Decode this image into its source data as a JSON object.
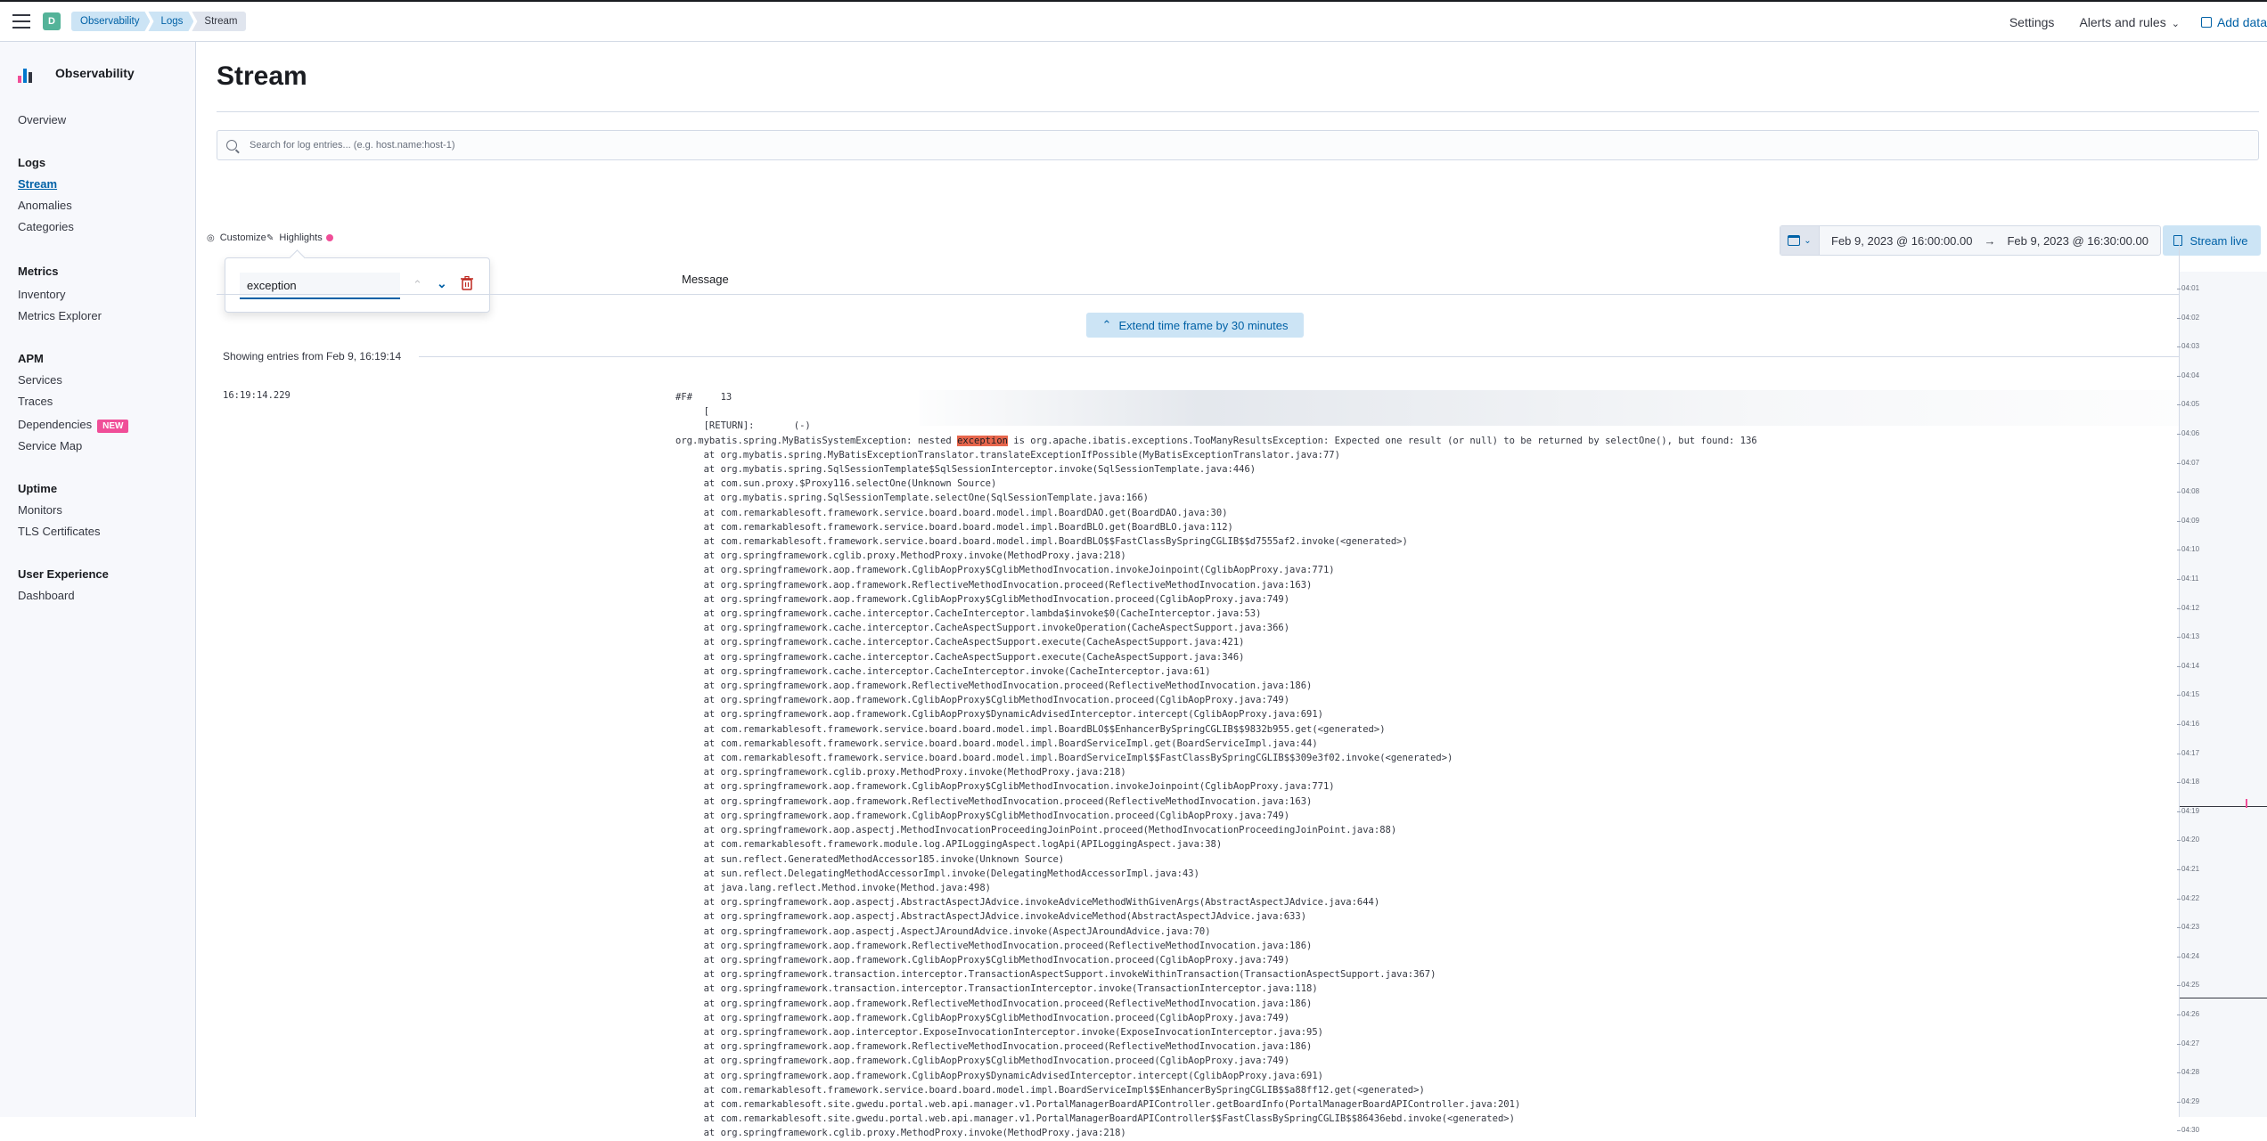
{
  "topbar": {
    "space_initial": "D",
    "breadcrumbs": [
      "Observability",
      "Logs",
      "Stream"
    ],
    "settings": "Settings",
    "alerts": "Alerts and rules",
    "add_data": "Add data"
  },
  "sidebar": {
    "title": "Observability",
    "sections": [
      {
        "items": [
          "Overview"
        ]
      },
      {
        "heading": "Logs",
        "items": [
          "Stream",
          "Anomalies",
          "Categories"
        ]
      },
      {
        "heading": "Metrics",
        "items": [
          "Inventory",
          "Metrics Explorer"
        ]
      },
      {
        "heading": "APM",
        "items": [
          "Services",
          "Traces",
          "Dependencies",
          "Service Map"
        ]
      },
      {
        "heading": "Uptime",
        "items": [
          "Monitors",
          "TLS Certificates"
        ]
      },
      {
        "heading": "User Experience",
        "items": [
          "Dashboard"
        ]
      }
    ],
    "active_item": "Stream",
    "new_badge": "NEW"
  },
  "page": {
    "title": "Stream",
    "search_placeholder": "Search for log entries... (e.g. host.name:host-1)",
    "customize": "Customize",
    "highlights": "Highlights",
    "date_from": "Feb 9, 2023 @ 16:00:00.00",
    "date_to": "Feb 9, 2023 @ 16:30:00.00",
    "stream_live": "Stream live",
    "highlight_term": "exception",
    "message_column": "Message",
    "extend_btn": "Extend time frame by 30 minutes",
    "showing": "Showing entries from Feb 9, 16:19:14"
  },
  "log": {
    "timestamp": "16:19:14.229",
    "prefix": "#F#",
    "line_id": "13",
    "return_line": "[RETURN]:       (-)",
    "exception_prefix": "org.mybatis.spring.MyBatisSystemException: nested ",
    "exception_word": "exception",
    "exception_suffix": " is org.apache.ibatis.exceptions.TooManyResultsException: Expected one result (or null) to be returned by selectOne(), but found: 136",
    "stack": [
      "at org.mybatis.spring.MyBatisExceptionTranslator.translateExceptionIfPossible(MyBatisExceptionTranslator.java:77)",
      "at org.mybatis.spring.SqlSessionTemplate$SqlSessionInterceptor.invoke(SqlSessionTemplate.java:446)",
      "at com.sun.proxy.$Proxy116.selectOne(Unknown Source)",
      "at org.mybatis.spring.SqlSessionTemplate.selectOne(SqlSessionTemplate.java:166)",
      "at com.remarkablesoft.framework.service.board.board.model.impl.BoardDAO.get(BoardDAO.java:30)",
      "at com.remarkablesoft.framework.service.board.board.model.impl.BoardBLO.get(BoardBLO.java:112)",
      "at com.remarkablesoft.framework.service.board.board.model.impl.BoardBLO$$FastClassBySpringCGLIB$$d7555af2.invoke(<generated>)",
      "at org.springframework.cglib.proxy.MethodProxy.invoke(MethodProxy.java:218)",
      "at org.springframework.aop.framework.CglibAopProxy$CglibMethodInvocation.invokeJoinpoint(CglibAopProxy.java:771)",
      "at org.springframework.aop.framework.ReflectiveMethodInvocation.proceed(ReflectiveMethodInvocation.java:163)",
      "at org.springframework.aop.framework.CglibAopProxy$CglibMethodInvocation.proceed(CglibAopProxy.java:749)",
      "at org.springframework.cache.interceptor.CacheInterceptor.lambda$invoke$0(CacheInterceptor.java:53)",
      "at org.springframework.cache.interceptor.CacheAspectSupport.invokeOperation(CacheAspectSupport.java:366)",
      "at org.springframework.cache.interceptor.CacheAspectSupport.execute(CacheAspectSupport.java:421)",
      "at org.springframework.cache.interceptor.CacheAspectSupport.execute(CacheAspectSupport.java:346)",
      "at org.springframework.cache.interceptor.CacheInterceptor.invoke(CacheInterceptor.java:61)",
      "at org.springframework.aop.framework.ReflectiveMethodInvocation.proceed(ReflectiveMethodInvocation.java:186)",
      "at org.springframework.aop.framework.CglibAopProxy$CglibMethodInvocation.proceed(CglibAopProxy.java:749)",
      "at org.springframework.aop.framework.CglibAopProxy$DynamicAdvisedInterceptor.intercept(CglibAopProxy.java:691)",
      "at com.remarkablesoft.framework.service.board.board.model.impl.BoardBLO$$EnhancerBySpringCGLIB$$9832b955.get(<generated>)",
      "at com.remarkablesoft.framework.service.board.board.model.impl.BoardServiceImpl.get(BoardServiceImpl.java:44)",
      "at com.remarkablesoft.framework.service.board.board.model.impl.BoardServiceImpl$$FastClassBySpringCGLIB$$309e3f02.invoke(<generated>)",
      "at org.springframework.cglib.proxy.MethodProxy.invoke(MethodProxy.java:218)",
      "at org.springframework.aop.framework.CglibAopProxy$CglibMethodInvocation.invokeJoinpoint(CglibAopProxy.java:771)",
      "at org.springframework.aop.framework.ReflectiveMethodInvocation.proceed(ReflectiveMethodInvocation.java:163)",
      "at org.springframework.aop.framework.CglibAopProxy$CglibMethodInvocation.proceed(CglibAopProxy.java:749)",
      "at org.springframework.aop.aspectj.MethodInvocationProceedingJoinPoint.proceed(MethodInvocationProceedingJoinPoint.java:88)",
      "at com.remarkablesoft.framework.module.log.APILoggingAspect.logApi(APILoggingAspect.java:38)",
      "at sun.reflect.GeneratedMethodAccessor185.invoke(Unknown Source)",
      "at sun.reflect.DelegatingMethodAccessorImpl.invoke(DelegatingMethodAccessorImpl.java:43)",
      "at java.lang.reflect.Method.invoke(Method.java:498)",
      "at org.springframework.aop.aspectj.AbstractAspectJAdvice.invokeAdviceMethodWithGivenArgs(AbstractAspectJAdvice.java:644)",
      "at org.springframework.aop.aspectj.AbstractAspectJAdvice.invokeAdviceMethod(AbstractAspectJAdvice.java:633)",
      "at org.springframework.aop.aspectj.AspectJAroundAdvice.invoke(AspectJAroundAdvice.java:70)",
      "at org.springframework.aop.framework.ReflectiveMethodInvocation.proceed(ReflectiveMethodInvocation.java:186)",
      "at org.springframework.aop.framework.CglibAopProxy$CglibMethodInvocation.proceed(CglibAopProxy.java:749)",
      "at org.springframework.transaction.interceptor.TransactionAspectSupport.invokeWithinTransaction(TransactionAspectSupport.java:367)",
      "at org.springframework.transaction.interceptor.TransactionInterceptor.invoke(TransactionInterceptor.java:118)",
      "at org.springframework.aop.framework.ReflectiveMethodInvocation.proceed(ReflectiveMethodInvocation.java:186)",
      "at org.springframework.aop.framework.CglibAopProxy$CglibMethodInvocation.proceed(CglibAopProxy.java:749)",
      "at org.springframework.aop.interceptor.ExposeInvocationInterceptor.invoke(ExposeInvocationInterceptor.java:95)",
      "at org.springframework.aop.framework.ReflectiveMethodInvocation.proceed(ReflectiveMethodInvocation.java:186)",
      "at org.springframework.aop.framework.CglibAopProxy$CglibMethodInvocation.proceed(CglibAopProxy.java:749)",
      "at org.springframework.aop.framework.CglibAopProxy$DynamicAdvisedInterceptor.intercept(CglibAopProxy.java:691)",
      "at com.remarkablesoft.framework.service.board.board.model.impl.BoardServiceImpl$$EnhancerBySpringCGLIB$$a88ff12.get(<generated>)",
      "at com.remarkablesoft.site.gwedu.portal.web.api.manager.v1.PortalManagerBoardAPIController.getBoardInfo(PortalManagerBoardAPIController.java:201)",
      "at com.remarkablesoft.site.gwedu.portal.web.api.manager.v1.PortalManagerBoardAPIController$$FastClassBySpringCGLIB$$86436ebd.invoke(<generated>)",
      "at org.springframework.cglib.proxy.MethodProxy.invoke(MethodProxy.java:218)"
    ]
  },
  "minimap": {
    "ticks": [
      "04:01",
      "04:02",
      "04:03",
      "04:04",
      "04:05",
      "04:06",
      "04:07",
      "04:08",
      "04:09",
      "04:10",
      "04:11",
      "04:12",
      "04:13",
      "04:14",
      "04:15",
      "04:16",
      "04:17",
      "04:18",
      "04:19",
      "04:20",
      "04:21",
      "04:22",
      "04:23",
      "04:24",
      "04:25",
      "04:26",
      "04:27",
      "04:28",
      "04:29",
      "04:30"
    ]
  },
  "colors": {
    "accent": "#0061a6",
    "highlight": "#e7664c",
    "badge": "#f04e98"
  }
}
